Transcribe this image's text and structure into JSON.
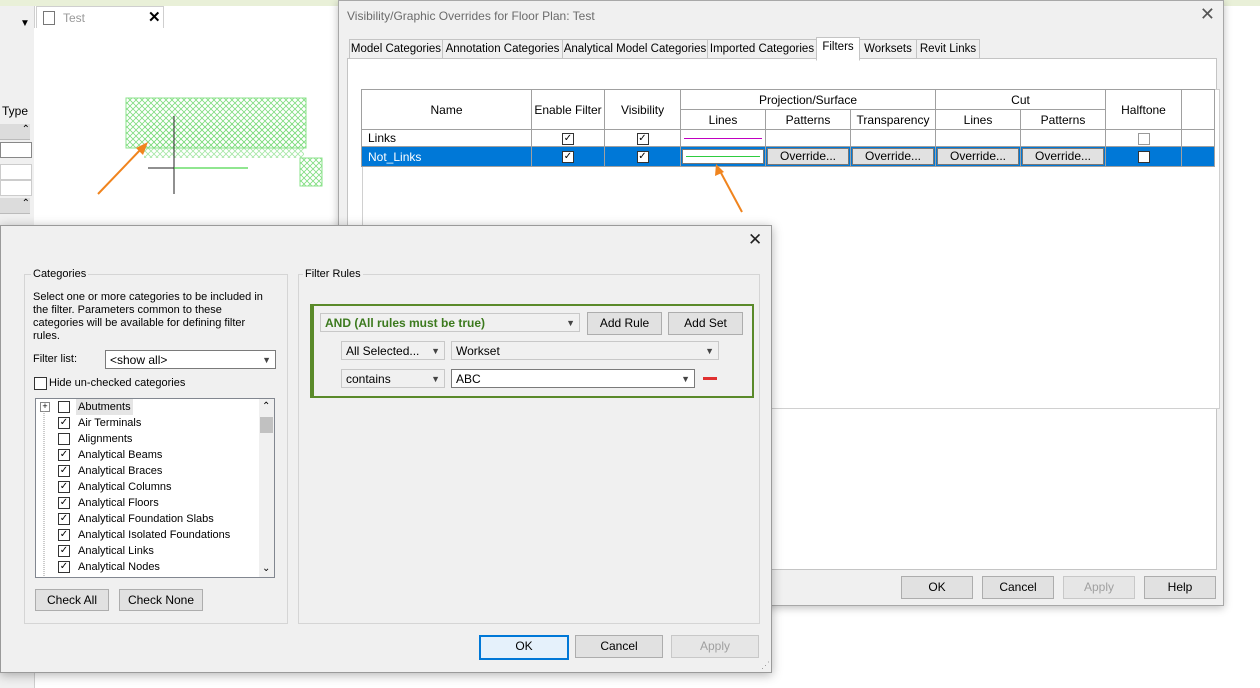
{
  "background": {
    "view_tab_title": "Test",
    "left_panel_label": "Type"
  },
  "vg_dialog": {
    "title": "Visibility/Graphic Overrides for Floor Plan: Test",
    "tabs": [
      "Model Categories",
      "Annotation Categories",
      "Analytical Model Categories",
      "Imported Categories",
      "Filters",
      "Worksets",
      "Revit Links"
    ],
    "active_tab": "Filters",
    "table": {
      "headers": {
        "name": "Name",
        "enable_filter": "Enable Filter",
        "visibility": "Visibility",
        "projection_surface": "Projection/Surface",
        "cut": "Cut",
        "halftone": "Halftone",
        "lines": "Lines",
        "patterns": "Patterns",
        "transparency": "Transparency"
      },
      "rows": [
        {
          "name": "Links",
          "enable": true,
          "visible": true,
          "line_color": "#c000c0",
          "halftone": false
        },
        {
          "name": "Not_Links",
          "enable": true,
          "visible": true,
          "line_color": "#2ecc40",
          "halftone": false,
          "override_label": "Override..."
        }
      ]
    },
    "buttons": {
      "ok": "OK",
      "cancel": "Cancel",
      "apply": "Apply",
      "help": "Help"
    }
  },
  "filter_dialog": {
    "categories": {
      "group_label": "Categories",
      "description": "Select one or more categories to be included in the filter.  Parameters common to these categories will be available for defining filter rules.",
      "filter_list_label": "Filter list:",
      "filter_list_value": "<show all>",
      "hide_unchecked_label": "Hide un-checked categories",
      "items": [
        {
          "label": "Abutments",
          "checked": false,
          "expandable": true
        },
        {
          "label": "Air Terminals",
          "checked": true
        },
        {
          "label": "Alignments",
          "checked": false
        },
        {
          "label": "Analytical Beams",
          "checked": true
        },
        {
          "label": "Analytical Braces",
          "checked": true
        },
        {
          "label": "Analytical Columns",
          "checked": true
        },
        {
          "label": "Analytical Floors",
          "checked": true
        },
        {
          "label": "Analytical Foundation Slabs",
          "checked": true
        },
        {
          "label": "Analytical Isolated Foundations",
          "checked": true
        },
        {
          "label": "Analytical Links",
          "checked": true
        },
        {
          "label": "Analytical Nodes",
          "checked": true
        }
      ],
      "check_all": "Check All",
      "check_none": "Check None"
    },
    "rules": {
      "group_label": "Filter Rules",
      "operator": "AND (All rules must be true)",
      "add_rule": "Add Rule",
      "add_set": "Add Set",
      "category_scope": "All Selected...",
      "parameter": "Workset",
      "condition": "contains",
      "value": "ABC"
    },
    "buttons": {
      "ok": "OK",
      "cancel": "Cancel",
      "apply": "Apply"
    }
  },
  "colors": {
    "accent": "#0078d7",
    "arrow": "#f0841e",
    "rule_border": "#5a8a2a",
    "rule_text": "#3c7a1e",
    "remove": "#e03030"
  }
}
